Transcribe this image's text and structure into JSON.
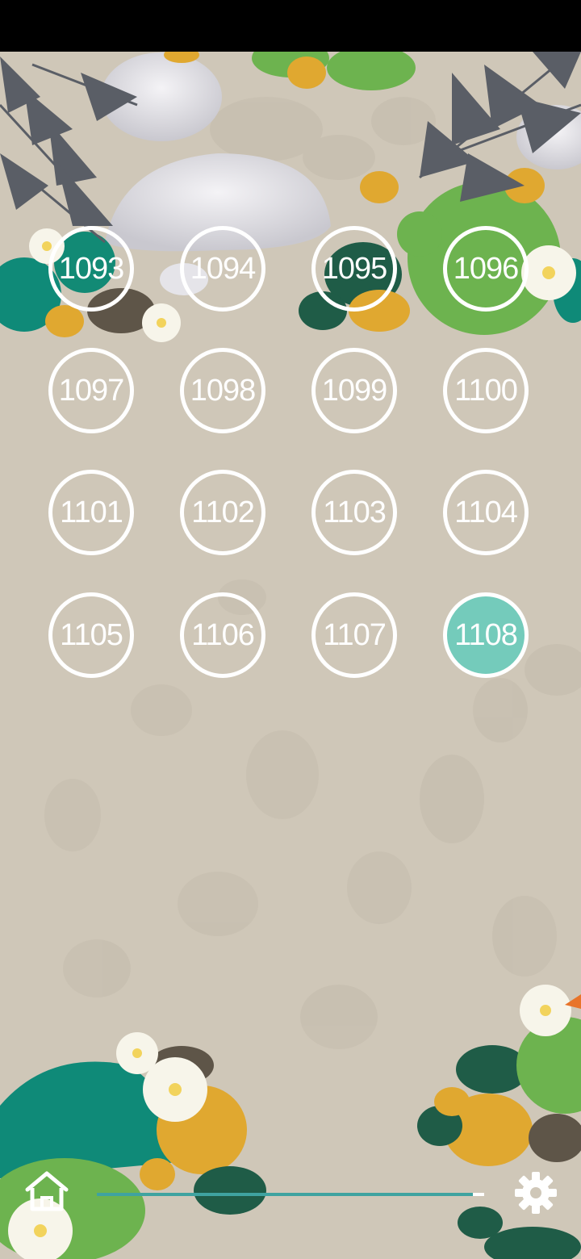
{
  "game": {
    "levels": [
      "1093",
      "1094",
      "1095",
      "1096",
      "1097",
      "1098",
      "1099",
      "1100",
      "1101",
      "1102",
      "1103",
      "1104",
      "1105",
      "1106",
      "1107",
      "1108"
    ],
    "current_level": "1108",
    "progress": 0.97
  },
  "colors": {
    "sand": "#cfc7b8",
    "current_level_fill": "#74cbbb",
    "level_ring": "#ffffff",
    "progress_fill": "#3fa3a0",
    "lily_pad_teal": "#0f8a78",
    "lily_pad_green": "#6db34f",
    "lily_pad_yellow": "#e0a830",
    "lily_pad_dark": "#1f5c47"
  },
  "icons": {
    "home": "home-icon",
    "settings": "gear-icon"
  }
}
